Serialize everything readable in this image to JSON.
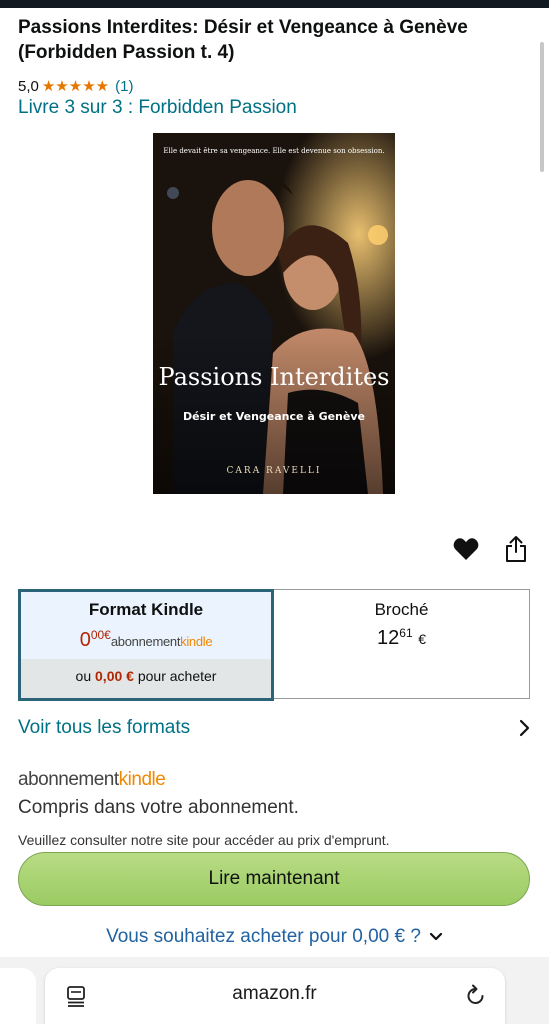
{
  "product": {
    "title": "Passions Interdites: Désir et Vengeance à Genève (Forbidden Passion t. 4)",
    "rating_value": "5,0",
    "stars": "★★★★★",
    "rating_count": "(1)",
    "series_link": "Livre 3 sur 3 : Forbidden Passion"
  },
  "cover": {
    "tagline": "Elle devait être sa vengeance. Elle est devenue son obsession.",
    "title": "Passions Interdites",
    "subtitle": "Désir et Vengeance à Genève",
    "author": "CARA RAVELLI"
  },
  "formats": {
    "kindle": {
      "name": "Format Kindle",
      "price_main": "0",
      "price_cents": "00",
      "price_currency": "€",
      "sub_logo_text": "abonnement",
      "sub_logo_brand": "kindle",
      "buy_prefix": "ou",
      "buy_price": "0,00 €",
      "buy_suffix": "pour acheter"
    },
    "paperback": {
      "name": "Broché",
      "price_main": "12",
      "price_cents": "61",
      "price_currency": "€"
    }
  },
  "all_formats_link": "Voir tous les formats",
  "subscription": {
    "logo_text": "abonnement",
    "logo_brand": "kindle",
    "included_text": "Compris dans votre abonnement.",
    "notice": "Veuillez consulter notre site pour accéder au prix d'emprunt.",
    "read_button": "Lire maintenant",
    "buy_question": "Vous souhaitez acheter pour 0,00 € ?"
  },
  "browser": {
    "url": "amazon.fr"
  },
  "colors": {
    "link": "#007185",
    "price_red": "#b12704",
    "star": "#e77600",
    "kindle_orange": "#f08804",
    "selected_border": "#2b6378",
    "button_green": "#a6d16f"
  }
}
